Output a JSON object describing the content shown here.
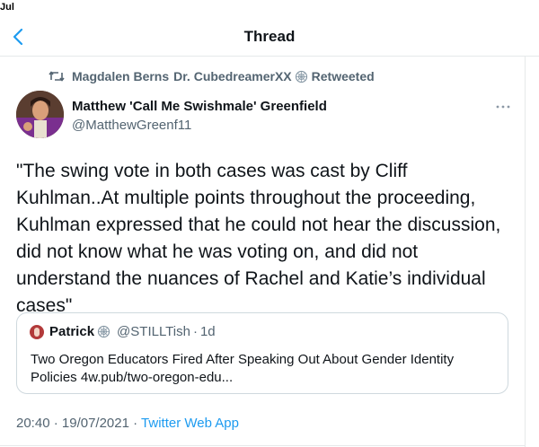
{
  "status_bar": {
    "time": "Jul"
  },
  "nav": {
    "title": "Thread",
    "back_icon": "chevron-left-icon"
  },
  "retweet": {
    "retweeter_name_1": "Magdalen Berns",
    "retweeter_name_2": "Dr. CubedreamerXX",
    "suffix": "Retweeted"
  },
  "tweet": {
    "author_name": "Matthew 'Call Me Swishmale' Greenfield",
    "author_handle": "@MatthewGreenf11",
    "body": "\"The swing vote in both cases was cast by Cliff Kuhlman..At multiple points throughout the proceeding, Kuhlman expressed that he could not hear the discussion, did not know what he was voting on, and did not understand the nuances of Rachel and Katie’s individual cases\"",
    "time": "20:40",
    "date": "19/07/2021",
    "source_app": "Twitter Web App"
  },
  "quote": {
    "name": "Patrick",
    "handle": "@STILLTish",
    "age": "1d",
    "text": "Two Oregon Educators Fired After Speaking Out About Gender Identity Policies 4w.pub/two-oregon-edu..."
  },
  "colors": {
    "accent": "#1d9bf0",
    "muted_text": "#536471",
    "primary_text": "#0f1419",
    "border": "#cfd9de"
  }
}
